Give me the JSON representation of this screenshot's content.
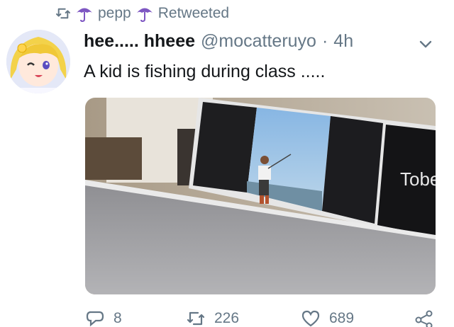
{
  "retweet": {
    "icon": "retweet-icon",
    "user_icon": "umbrella-icon",
    "user": "pepp",
    "status_icon": "umbrella-icon",
    "label": "Retweeted"
  },
  "tweet": {
    "avatar": "anime-avatar",
    "display_name": "hee..... hheee",
    "handle": "@mocatteruyo",
    "separator": "·",
    "time": "4h",
    "menu_icon": "chevron-down-icon",
    "text": "A kid is fishing during class .....",
    "media": {
      "type": "photo-of-screen",
      "description_icon": "video-still",
      "overlay_text": "Tobe"
    }
  },
  "actions": {
    "reply": {
      "icon": "reply-icon",
      "count": "8"
    },
    "retweet": {
      "icon": "retweet-icon",
      "count": "226"
    },
    "like": {
      "icon": "heart-icon",
      "count": "689"
    },
    "share": {
      "icon": "share-icon"
    }
  },
  "colors": {
    "text": "#14171a",
    "secondary": "#657786",
    "umbrella": "#7e57c2",
    "background": "#ffffff"
  }
}
